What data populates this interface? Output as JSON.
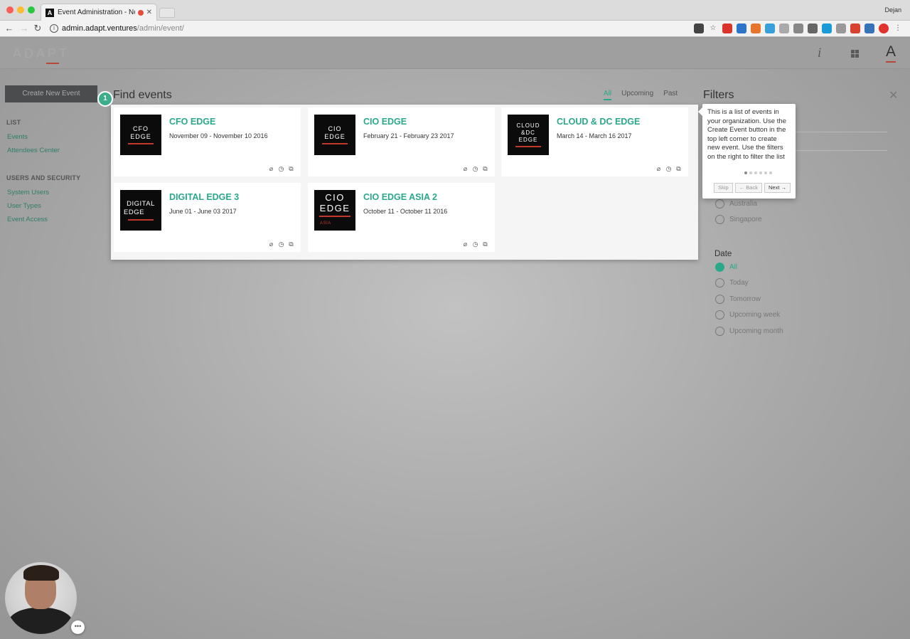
{
  "browser": {
    "tab_title": "Event Administration - Nov",
    "tab_favicon_letter": "A",
    "user_name": "Dejan",
    "url_host": "admin.adapt.ventures",
    "url_path": "/admin/event/"
  },
  "header": {
    "logo_text": "ADAPT",
    "info_label": "i",
    "account_label": "A"
  },
  "sidebar": {
    "create_button": "Create New Event",
    "section_list": "LIST",
    "list_items": [
      "Events",
      "Attendees Center"
    ],
    "section_users": "USERS AND SECURITY",
    "users_items": [
      "System Users",
      "User Types",
      "Event Access"
    ]
  },
  "main": {
    "step_number": "1",
    "title": "Find events",
    "tabs": [
      "All",
      "Upcoming",
      "Past"
    ],
    "active_tab": "All",
    "events": [
      {
        "thumb_lines": [
          "CFO",
          "EDGE"
        ],
        "title": "CFO EDGE",
        "dates": "November 09 - November 10 2016"
      },
      {
        "thumb_lines": [
          "CIO",
          "EDGE"
        ],
        "title": "CIO EDGE",
        "dates": "February 21 - February 23 2017"
      },
      {
        "thumb_lines": [
          "CLOUD",
          "&DC",
          "EDGE"
        ],
        "title": "CLOUD & DC EDGE",
        "dates": "March 14 - March 16 2017"
      },
      {
        "thumb_lines": [
          "DIGITAL",
          "EDGE"
        ],
        "title": "DIGITAL EDGE 3",
        "dates": "June 01 - June 03 2017"
      },
      {
        "thumb_lines": [
          "CIO",
          "EDGE"
        ],
        "thumb_sub": "ASIA",
        "title": "CIO EDGE ASIA 2",
        "dates": "October 11 - October 11 2016"
      }
    ]
  },
  "filters": {
    "title": "Filters",
    "location_options": [
      "Australia",
      "Singapore"
    ],
    "date_label": "Date",
    "date_options": [
      "All",
      "Today",
      "Tomorrow",
      "Upcoming week",
      "Upcoming month"
    ],
    "date_selected": "All"
  },
  "tooltip": {
    "text": "This is a list of events in your organization. Use the Create Event button in the top left corner to create new event. Use the filters on the right to filter the list",
    "total_steps": 6,
    "current_step": 1,
    "skip_label": "Skip",
    "back_label": "← Back",
    "next_label": "Next →"
  },
  "colors": {
    "accent": "#2aa88a",
    "brand_red": "#c0392b",
    "sidebar_button": "#4a4c4e"
  }
}
